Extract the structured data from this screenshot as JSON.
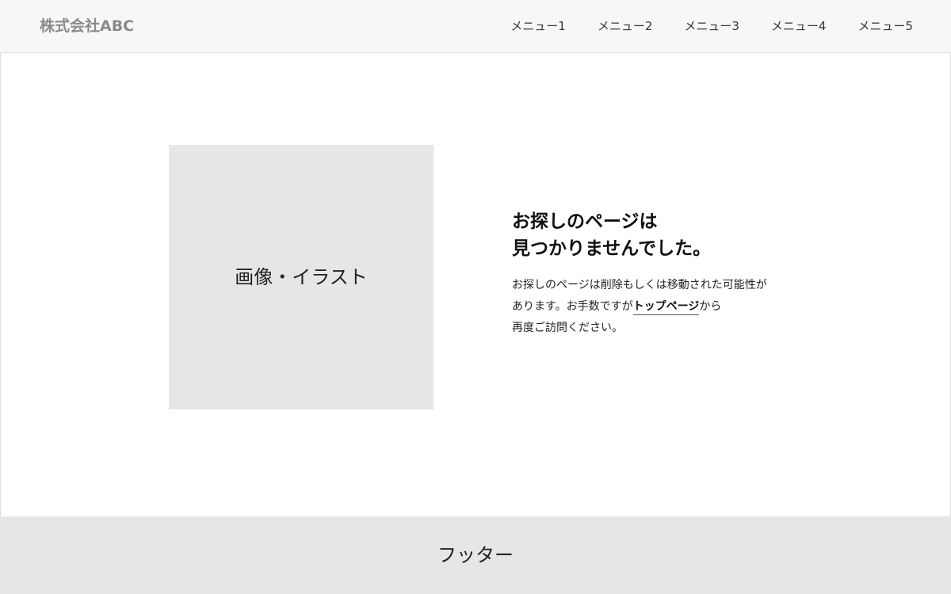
{
  "header": {
    "logo": "株式会社ABC",
    "nav": [
      "メニュー1",
      "メニュー2",
      "メニュー3",
      "メニュー4",
      "メニュー5"
    ]
  },
  "main": {
    "image_label": "画像・イラスト",
    "heading_line1": "お探しのページは",
    "heading_line2": "見つかりませんでした。",
    "desc_line1": "お探しのページは削除もしくは移動された可能性が",
    "desc_line2_before": "あります。お手数ですが",
    "desc_link": "トップページ",
    "desc_line2_after": "から",
    "desc_line3": "再度ご訪問ください。"
  },
  "footer": {
    "label": "フッター"
  }
}
